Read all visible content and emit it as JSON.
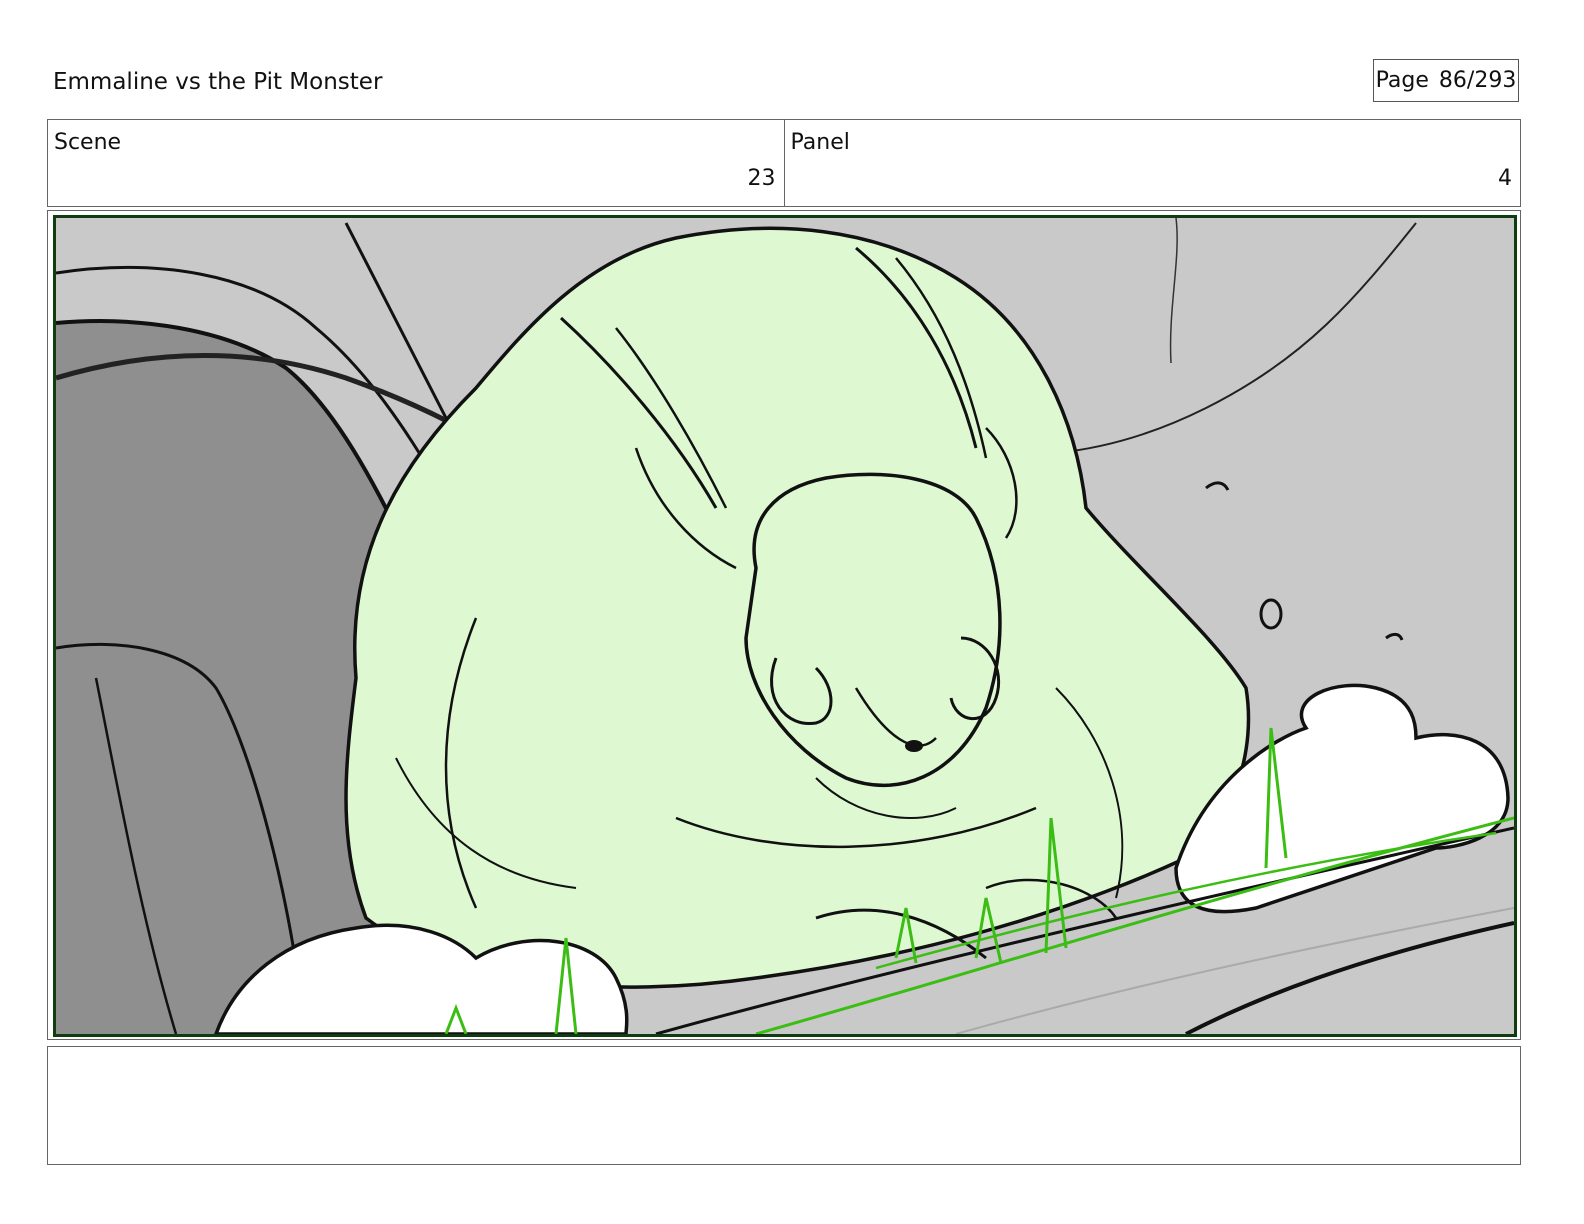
{
  "header": {
    "title": "Emmaline vs the Pit Monster",
    "page_label": "Page",
    "page_value": "86/293"
  },
  "meta": {
    "scene_label": "Scene",
    "scene_value": "23",
    "panel_label": "Panel",
    "panel_value": "4"
  },
  "notes": {
    "text": ""
  },
  "colors": {
    "creature_fill": "#def9d2",
    "background_gray": "#c9c9c9",
    "wall_dark": "#8f8f8f",
    "grass_green": "#3bbd14",
    "frame_border": "#0f3d0f"
  }
}
